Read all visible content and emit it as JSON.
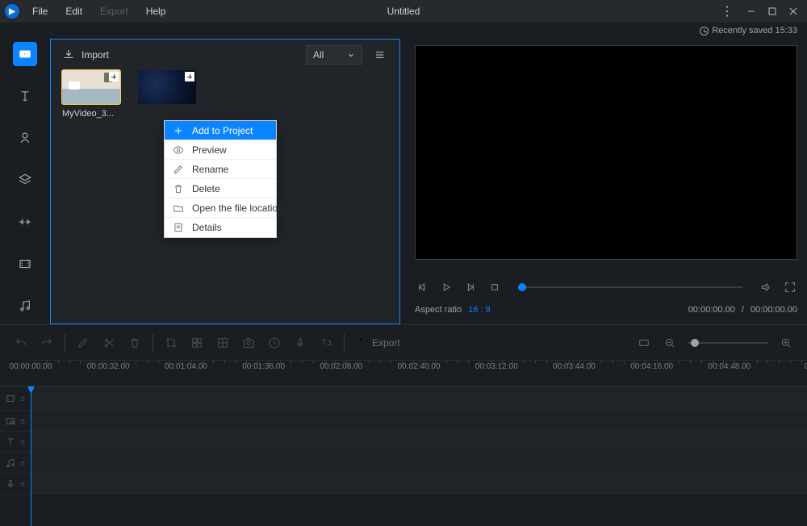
{
  "titlebar": {
    "title": "Untitled",
    "menus": {
      "file": "File",
      "edit": "Edit",
      "export": "Export",
      "help": "Help"
    }
  },
  "status": {
    "recently_saved": "Recently saved 15:33"
  },
  "media_panel": {
    "import_label": "Import",
    "filter_selected": "All",
    "thumb1_label": "MyVideo_3..."
  },
  "context_menu": {
    "add": "Add to Project",
    "preview": "Preview",
    "rename": "Rename",
    "delete": "Delete",
    "open_loc": "Open the file location",
    "details": "Details"
  },
  "preview": {
    "aspect_label": "Aspect ratio",
    "aspect_value": "16 : 9",
    "time_current": "00:00:00.00",
    "time_total": "00:00:00.00"
  },
  "timeline_toolbar": {
    "export": "Export"
  },
  "ruler": {
    "marks": [
      "00:00:00.00",
      "00:00:32.00",
      "00:01:04.00",
      "00:01:36.00",
      "00:02:08.00",
      "00:02:40.00",
      "00:03:12.00",
      "00:03:44.00",
      "00:04:16.00",
      "00:04:48.00"
    ],
    "end": "0"
  }
}
